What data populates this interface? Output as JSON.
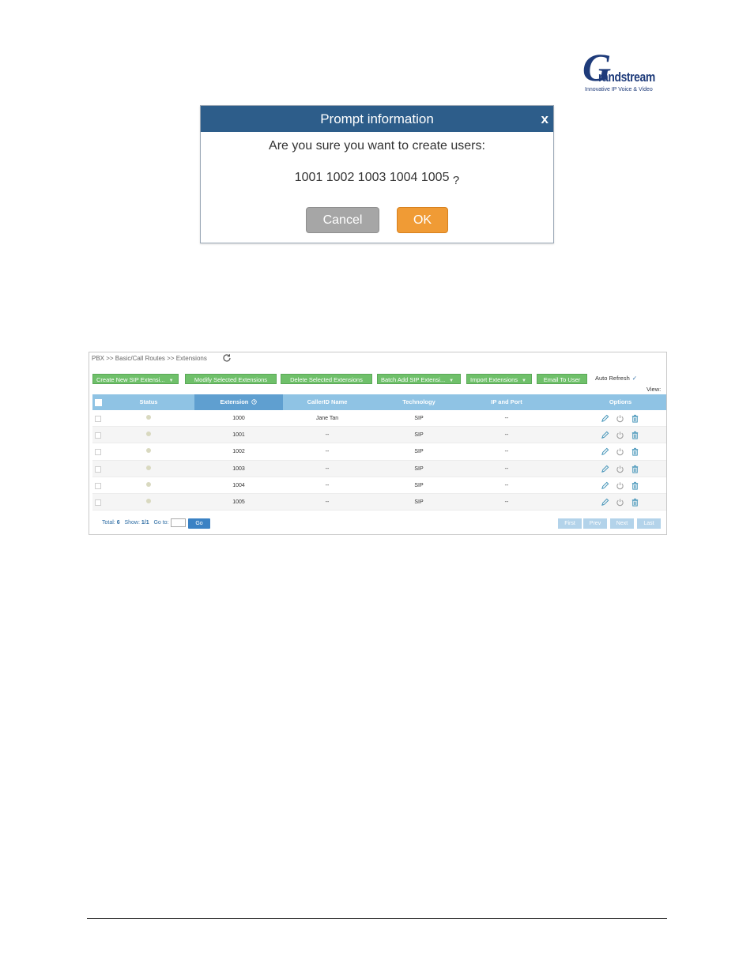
{
  "logo": {
    "letter": "G",
    "word": "randstream",
    "tagline": "Innovative IP Voice & Video"
  },
  "dialog": {
    "title": "Prompt information",
    "close": "x",
    "message": "Are you sure you want to create users:",
    "users": "1001 1002 1003 1004 1005",
    "question": "?",
    "cancel_label": "Cancel",
    "ok_label": "OK"
  },
  "extensions": {
    "breadcrumb": "PBX >> Basic/Call Routes >> Extensions",
    "toolbar": {
      "create": "Create New SIP Extensi...",
      "modify": "Modify Selected Extensions",
      "delete": "Delete Selected Extensions",
      "batch": "Batch Add SIP Extensi...",
      "import": "Import Extensions",
      "email": "Email To User",
      "auto_refresh": "Auto Refresh",
      "auto_refresh_checked": "✓",
      "view": "View:",
      "caret": "▼"
    },
    "columns": [
      "Status",
      "Extension",
      "CallerID Name",
      "Technology",
      "IP and Port",
      "Options"
    ],
    "rows": [
      {
        "extension": "1000",
        "caller_id": "Jane Tan",
        "technology": "SIP",
        "ip": "--"
      },
      {
        "extension": "1001",
        "caller_id": "--",
        "technology": "SIP",
        "ip": "--"
      },
      {
        "extension": "1002",
        "caller_id": "--",
        "technology": "SIP",
        "ip": "--"
      },
      {
        "extension": "1003",
        "caller_id": "--",
        "technology": "SIP",
        "ip": "--"
      },
      {
        "extension": "1004",
        "caller_id": "--",
        "technology": "SIP",
        "ip": "--"
      },
      {
        "extension": "1005",
        "caller_id": "--",
        "technology": "SIP",
        "ip": "--"
      }
    ],
    "pager": {
      "total_label": "Total:",
      "total": "6",
      "show_label": "Show:",
      "show": "1/1",
      "goto_label": "Go to:",
      "go": "Go",
      "first": "First",
      "prev": "Prev",
      "next": "Next",
      "last": "Last"
    }
  },
  "colors": {
    "dialog_header": "#2d5d8a",
    "ok": "#f09b35",
    "cancel": "#a6a6a6",
    "toolbar_button": "#6fc06a",
    "grid_header": "#8fc3e4",
    "sorted_header": "#5f9fd0",
    "option_icon": "#3b8fb5"
  },
  "icons": [
    "refresh-icon",
    "clock-icon",
    "edit-icon",
    "power-icon",
    "trash-icon"
  ]
}
